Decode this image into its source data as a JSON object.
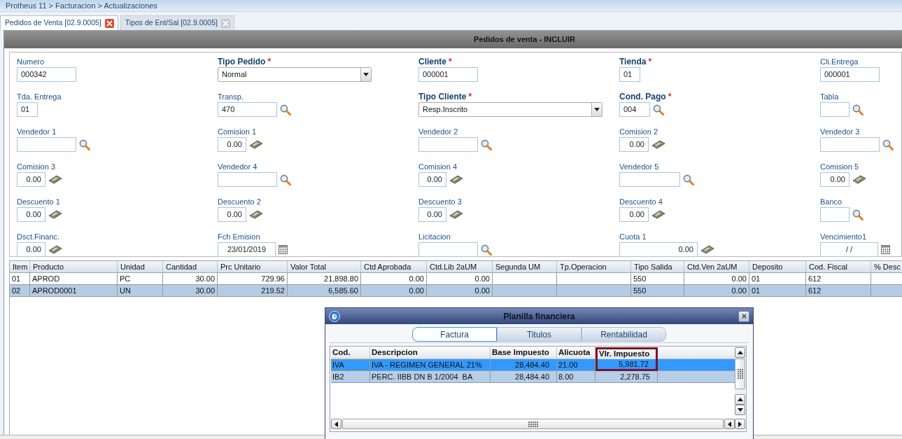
{
  "breadcrumb": "Protheus 11 > Facturacion > Actualizaciones",
  "tabs": [
    {
      "label": "Pedidos de Venta [02.9.0005]",
      "selected": true
    },
    {
      "label": "Tipos de Ent/Sal [02.9.0005]",
      "selected": false
    }
  ],
  "panel": {
    "title": "Pedidos de venta - INCLUIR"
  },
  "form": {
    "fields": [
      {
        "label": "Numero",
        "kind": "text",
        "value": "000342"
      },
      {
        "label": "Tipo Pedido",
        "mark": "*",
        "kind": "select",
        "value": "Normal"
      },
      {
        "label": "Cliente",
        "mark": "*",
        "kind": "text",
        "value": "000001"
      },
      {
        "label": "Tienda",
        "mark": "*",
        "kind": "text",
        "value": "01"
      },
      {
        "label": "Cli.Entrega",
        "kind": "text",
        "value": "000001"
      },
      {
        "label": "Tda. Entrega",
        "kind": "text",
        "value": "01"
      },
      {
        "label": "Transp.",
        "kind": "lookup",
        "value": "470"
      },
      {
        "label": "Tipo Cliente",
        "mark": "*",
        "kind": "select",
        "value": "Resp.Inscrito"
      },
      {
        "label": "Cond. Pago",
        "mark": "*",
        "kind": "lookup",
        "value": "004"
      },
      {
        "label": "Tabla",
        "kind": "lookup"
      },
      {
        "label": "Vendedor 1",
        "kind": "lookup"
      },
      {
        "label": "Comision 1",
        "kind": "number",
        "value": "0.00"
      },
      {
        "label": "Vendedor 2",
        "kind": "lookup"
      },
      {
        "label": "Comision 2",
        "kind": "number",
        "value": "0.00"
      },
      {
        "label": "Vendedor 3",
        "kind": "lookup"
      },
      {
        "label": "Comision 3",
        "kind": "number",
        "value": "0.00"
      },
      {
        "label": "Vendedor 4",
        "kind": "lookup"
      },
      {
        "label": "Comision 4",
        "kind": "number",
        "value": "0.00"
      },
      {
        "label": "Vendedor 5",
        "kind": "lookup"
      },
      {
        "label": "Comision 5",
        "kind": "number",
        "value": "0.00"
      },
      {
        "label": "Descuento 1",
        "kind": "number",
        "value": "0.00"
      },
      {
        "label": "Descuento 2",
        "kind": "number",
        "value": "0.00"
      },
      {
        "label": "Descuento 3",
        "kind": "number",
        "value": "0.00"
      },
      {
        "label": "Descuento 4",
        "kind": "number",
        "value": "0.00"
      },
      {
        "label": "Banco",
        "kind": "lookup"
      },
      {
        "label": "Dsct.Financ.",
        "kind": "number",
        "value": "0.00"
      },
      {
        "label": "Fch Emision",
        "kind": "date",
        "value": "23/01/2019"
      },
      {
        "label": "Licitacion",
        "kind": "lookup"
      },
      {
        "label": "Cuota 1",
        "kind": "number",
        "value": "0.00"
      },
      {
        "label": "Vencimiento1",
        "kind": "date",
        "value": "/ /"
      }
    ]
  },
  "items_table": {
    "columns": [
      {
        "label": "Item",
        "kind": "text"
      },
      {
        "label": "Producto",
        "kind": "text"
      },
      {
        "label": "Unidad",
        "kind": "text"
      },
      {
        "label": "Cantidad",
        "kind": "number"
      },
      {
        "label": "Prc Unitario",
        "kind": "number"
      },
      {
        "label": "Valor Total",
        "kind": "number"
      },
      {
        "label": "Ctd Aprobada",
        "kind": "number"
      },
      {
        "label": "Ctd.Lib 2aUM",
        "kind": "number"
      },
      {
        "label": "Segunda UM",
        "kind": "text"
      },
      {
        "label": "Tp.Operacion",
        "kind": "text"
      },
      {
        "label": "Tipo Salida",
        "kind": "text"
      },
      {
        "label": "Ctd.Ven 2aUM",
        "kind": "number"
      },
      {
        "label": "Deposito",
        "kind": "text"
      },
      {
        "label": "Cod. Fiscal",
        "kind": "text"
      },
      {
        "label": "% Desc",
        "kind": "number"
      }
    ],
    "rows": [
      {
        "selected": false,
        "cells": [
          "01",
          "APROD",
          "PC",
          "30.00",
          "729.96",
          "21,898.80",
          "0.00",
          "0.00",
          null,
          null,
          "550",
          "0.00",
          "01",
          "612",
          null
        ]
      },
      {
        "selected": true,
        "cells": [
          "02",
          "APROD0001",
          "UN",
          "30.00",
          "219.52",
          "6,585.60",
          "0.00",
          "0.00",
          null,
          null,
          "550",
          "0.00",
          "01",
          "612",
          null
        ]
      }
    ]
  },
  "dialog": {
    "title": "Planilla financiera",
    "tabs": [
      {
        "label": "Factura",
        "selected": true
      },
      {
        "label": "Titulos",
        "selected": false
      },
      {
        "label": "Rentabilidad",
        "selected": false
      }
    ],
    "table": {
      "columns": [
        {
          "label": "Cod.",
          "kind": "text",
          "highlighted": false
        },
        {
          "label": "Descripcion",
          "kind": "text",
          "highlighted": false
        },
        {
          "label": "Base Impuesto",
          "kind": "number",
          "highlighted": false
        },
        {
          "label": "Alicuota",
          "kind": "text",
          "highlighted": false
        },
        {
          "label": "Vlr. Impuesto",
          "kind": "number",
          "highlighted": true
        }
      ],
      "rows": [
        {
          "selected": true,
          "cells": [
            "IVA",
            "IVA - REGIMEN GENERAL 21%",
            "28,484.40",
            "21.00",
            "5,981.72"
          ]
        },
        {
          "selected": false,
          "cells": [
            "IB2",
            "PERC. IIBB DN B 1/2004  BA",
            "28,484.40",
            "8.00",
            "2,278.75"
          ]
        }
      ]
    }
  }
}
